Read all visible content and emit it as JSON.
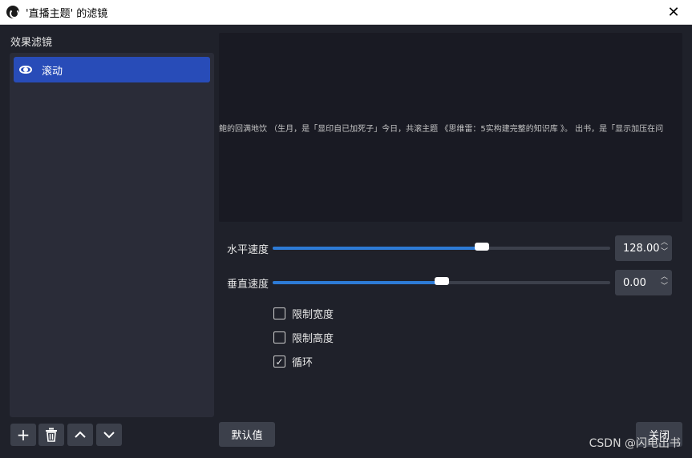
{
  "window": {
    "title": "'直播主题' 的滤镜",
    "close_glyph": "✕"
  },
  "filters": {
    "label": "效果滤镜",
    "items": [
      {
        "name": "滚动",
        "visible": true,
        "selected": true
      }
    ]
  },
  "toolbar": {
    "add_glyph": "+",
    "up_glyph": "⌃",
    "down_glyph": "⌄"
  },
  "preview": {
    "text": "鲍的回满地饮 （生月，是「显印自已加死子」今日，共滚主题 《思维雷：5实构建完整的知识库 》。      出书，是「显示加压在问"
  },
  "settings": {
    "horizontal_speed": {
      "label": "水平速度",
      "value": "128.00",
      "slider_fraction": 0.62
    },
    "vertical_speed": {
      "label": "垂直速度",
      "value": "0.00",
      "slider_fraction": 0.5
    },
    "limit_width": {
      "label": "限制宽度",
      "checked": false
    },
    "limit_height": {
      "label": "限制高度",
      "checked": false
    },
    "loop": {
      "label": "循环",
      "checked": true,
      "check_glyph": "✓"
    }
  },
  "buttons": {
    "defaults": "默认值",
    "close": "关闭"
  },
  "watermark": "CSDN @闪电出书",
  "colors": {
    "background": "#1f212a",
    "panel": "#2a2c38",
    "selected": "#284cb8",
    "slider_fill": "#2d7bd6",
    "button": "#3c404b"
  }
}
